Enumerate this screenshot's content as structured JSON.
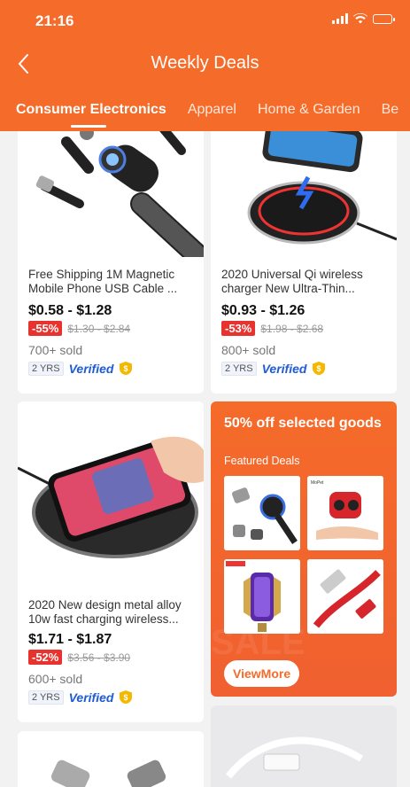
{
  "status": {
    "time": "21:16"
  },
  "nav": {
    "title": "Weekly Deals"
  },
  "tabs": [
    "Consumer Electronics",
    "Apparel",
    "Home & Garden",
    "Be"
  ],
  "products": [
    {
      "title": "Free Shipping 1M Magnetic Mobile Phone USB Cable ...",
      "price": "$0.58 - $1.28",
      "discount": "-55%",
      "original": "$1.30 - $2.84",
      "sold": "700+ sold",
      "years": "2 YRS",
      "verified": "Verified"
    },
    {
      "title": "2020 Universal Qi wireless charger New Ultra-Thin...",
      "price": "$0.93 - $1.26",
      "discount": "-53%",
      "original": "$1.98 - $2.68",
      "sold": "800+ sold",
      "years": "2 YRS",
      "verified": "Verified"
    },
    {
      "title": "2020 New design metal alloy 10w fast charging wireless...",
      "price": "$1.71 - $1.87",
      "discount": "-52%",
      "original": "$3.56 - $3.90",
      "sold": "600+ sold",
      "years": "2 YRS",
      "verified": "Verified"
    }
  ],
  "promo": {
    "title": "50% off selected goods",
    "subtitle": "Featured Deals",
    "button": "ViewMore"
  },
  "icons": {
    "back": "chevron-left-icon",
    "verified_shield": "shield-dollar-icon"
  },
  "colors": {
    "accent": "#f56b2a",
    "discount": "#e8322e",
    "verified": "#1e5bd7"
  }
}
